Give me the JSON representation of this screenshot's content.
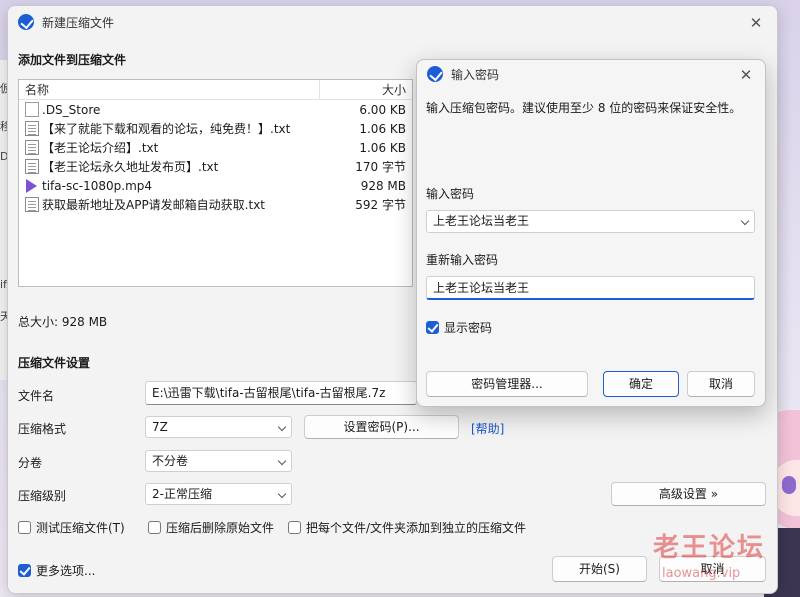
{
  "main_window": {
    "title": "新建压缩文件",
    "add_files_title": "添加文件到压缩文件",
    "file_list": {
      "columns": {
        "name": "名称",
        "size": "大小"
      },
      "rows": [
        {
          "name": ".DS_Store",
          "size": "6.00 KB",
          "icon": "blank-file-icon"
        },
        {
          "name": "【来了就能下载和观看的论坛，纯免费！】.txt",
          "size": "1.06 KB",
          "icon": "text-file-icon"
        },
        {
          "name": "【老王论坛介绍】.txt",
          "size": "1.06 KB",
          "icon": "text-file-icon"
        },
        {
          "name": "【老王论坛永久地址发布页】.txt",
          "size": "170 字节",
          "icon": "text-file-icon"
        },
        {
          "name": "tifa-sc-1080p.mp4",
          "size": "928 MB",
          "icon": "video-file-icon"
        },
        {
          "name": "获取最新地址及APP请发邮箱自动获取.txt",
          "size": "592 字节",
          "icon": "text-file-icon"
        }
      ]
    },
    "total_size": "总大小: 928 MB",
    "settings_title": "压缩文件设置",
    "filename_label": "文件名",
    "filename_value": "E:\\迅雷下载\\tifa-古留根尾\\tifa-古留根尾.7z",
    "format_label": "压缩格式",
    "format_value": "7Z",
    "set_password_button": "设置密码(P)...",
    "help_link": "[帮助]",
    "volume_label": "分卷",
    "volume_value": "不分卷",
    "level_label": "压缩级别",
    "level_value": "2-正常压缩",
    "advanced_button": "高级设置 »",
    "test_checkbox": "测试压缩文件(T)",
    "delete_checkbox": "压缩后删除原始文件",
    "separate_checkbox": "把每个文件/文件夹添加到独立的压缩文件",
    "more_options_checkbox": "更多选项...",
    "start_button": "开始(S)",
    "cancel_button": "取消"
  },
  "password_dialog": {
    "title": "输入密码",
    "description": "输入压缩包密码。建议使用至少 8 位的密码来保证安全性。",
    "password_label": "输入密码",
    "password_value": "上老王论坛当老王",
    "confirm_label": "重新输入密码",
    "confirm_value": "上老王论坛当老王",
    "show_password_label": "显示密码",
    "show_password_checked": true,
    "manager_button": "密码管理器...",
    "ok_button": "确定",
    "cancel_button": "取消"
  },
  "background": {
    "left_glyphs": [
      "仮",
      "移",
      "D",
      "【",
      "【",
      "if",
      "天"
    ]
  },
  "watermark": {
    "title": "老王论坛",
    "url": "laowang.vip"
  },
  "colors": {
    "accent": "#1c5ed6",
    "link": "#1a56c9",
    "watermark": "#dc3c3c"
  }
}
